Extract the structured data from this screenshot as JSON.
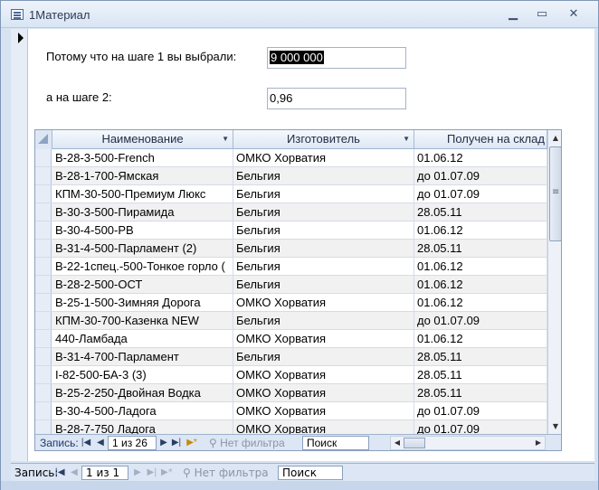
{
  "window": {
    "title": "1Материал"
  },
  "form": {
    "label_step1": "Потому что на шаге 1 вы выбрали:",
    "value_step1": "9 000 000",
    "label_step2": "а на шаге 2:",
    "value_step2": "0,96"
  },
  "grid": {
    "columns": [
      "Наименование",
      "Изготовитель",
      "Получен на склад"
    ],
    "rows": [
      [
        "В-28-3-500-French",
        "ОМКО Хорватия",
        "01.06.12"
      ],
      [
        "В-28-1-700-Ямская",
        "Бельгия",
        "до 01.07.09"
      ],
      [
        "КПМ-30-500-Премиум Люкс",
        "Бельгия",
        "до 01.07.09"
      ],
      [
        "В-30-3-500-Пирамида",
        "Бельгия",
        "28.05.11"
      ],
      [
        "В-30-4-500-РВ",
        "Бельгия",
        "01.06.12"
      ],
      [
        "В-31-4-500-Парламент (2)",
        "Бельгия",
        "28.05.11"
      ],
      [
        "В-22-1спец.-500-Тонкое горло (",
        "Бельгия",
        "01.06.12"
      ],
      [
        "В-28-2-500-ОСТ",
        "Бельгия",
        "01.06.12"
      ],
      [
        "В-25-1-500-Зимняя Дорога",
        "ОМКО Хорватия",
        "01.06.12"
      ],
      [
        "КПМ-30-700-Казенка NEW",
        "Бельгия",
        "до 01.07.09"
      ],
      [
        "440-Ламбада",
        "ОМКО Хорватия",
        "01.06.12"
      ],
      [
        "В-31-4-700-Парламент",
        "Бельгия",
        "28.05.11"
      ],
      [
        "I-82-500-БА-3 (3)",
        "ОМКО Хорватия",
        "28.05.11"
      ],
      [
        "В-25-2-250-Двойная Водка",
        "ОМКО Хорватия",
        "28.05.11"
      ],
      [
        "В-30-4-500-Ладога",
        "ОМКО Хорватия",
        "до 01.07.09"
      ],
      [
        "В-28-7-750 Ладога",
        "ОМКО Хорватия",
        "до 01.07.09"
      ]
    ]
  },
  "subform_nav": {
    "records_label": "Запись:",
    "position": "1 из 26",
    "filter_label": "Нет фильтра",
    "search_placeholder": "Поиск"
  },
  "main_nav": {
    "records_label": "Запись:",
    "position": "1 из 1",
    "filter_label": "Нет фильтра",
    "search_placeholder": "Поиск"
  },
  "icons": {
    "close": "close-icon",
    "maximize": "maximize-icon",
    "minimize": "minimize-icon"
  }
}
